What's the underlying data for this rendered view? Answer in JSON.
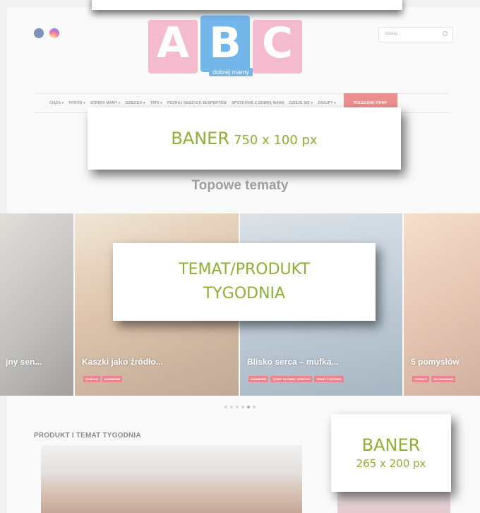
{
  "header": {
    "social": [
      "facebook-icon",
      "instagram-icon"
    ],
    "logo": {
      "letters": [
        "A",
        "B",
        "C"
      ],
      "subtitle": "dobrej mamy"
    },
    "search": {
      "placeholder": "szukaj..."
    }
  },
  "nav": {
    "items": [
      "CIĄŻA ▾",
      "PORÓD ▾",
      "STREFA MAMY ▾",
      "DZIECKO ▾",
      "TATA ▾",
      "POZNAJ NASZYCH EKSPERTÓW",
      "SPOTKANIE Z DOBRĄ MAMĄ",
      "DZIEJE SIĘ ▾",
      "ZAKUPY ▾"
    ],
    "highlight": "POLECANE FIRMY"
  },
  "banner_top": {
    "label": "BANER",
    "size": "750 x 100 px"
  },
  "section_title": "Topowe tematy",
  "slides": [
    {
      "title": "jny sen...",
      "tags": []
    },
    {
      "title": "Kaszki jako źródło...",
      "tags": [
        "DZIECKO",
        "KARMIENIE"
      ]
    },
    {
      "title": "Blisko serca – mufka...",
      "tags": [
        "KARMIENIE",
        "TEMAT GŁÓWNY: DZIECKO",
        "TEMAT TYGODNIA"
      ]
    },
    {
      "title": "5 pomysłów",
      "tags": [
        "DZIECKO",
        "WYCHOWANIE"
      ]
    }
  ],
  "feature_card": {
    "line1": "TEMAT/PRODUKT",
    "line2": "TYGODNIA"
  },
  "product_section": {
    "title": "PRODUKT I TEMAT TYGODNIA"
  },
  "banner_side": {
    "label": "BANER",
    "size": "265 x 200 px"
  },
  "colors": {
    "accent_green": "#8db032",
    "tag_pink": "#e8858d",
    "nav_highlight": "#ec8f8f"
  }
}
